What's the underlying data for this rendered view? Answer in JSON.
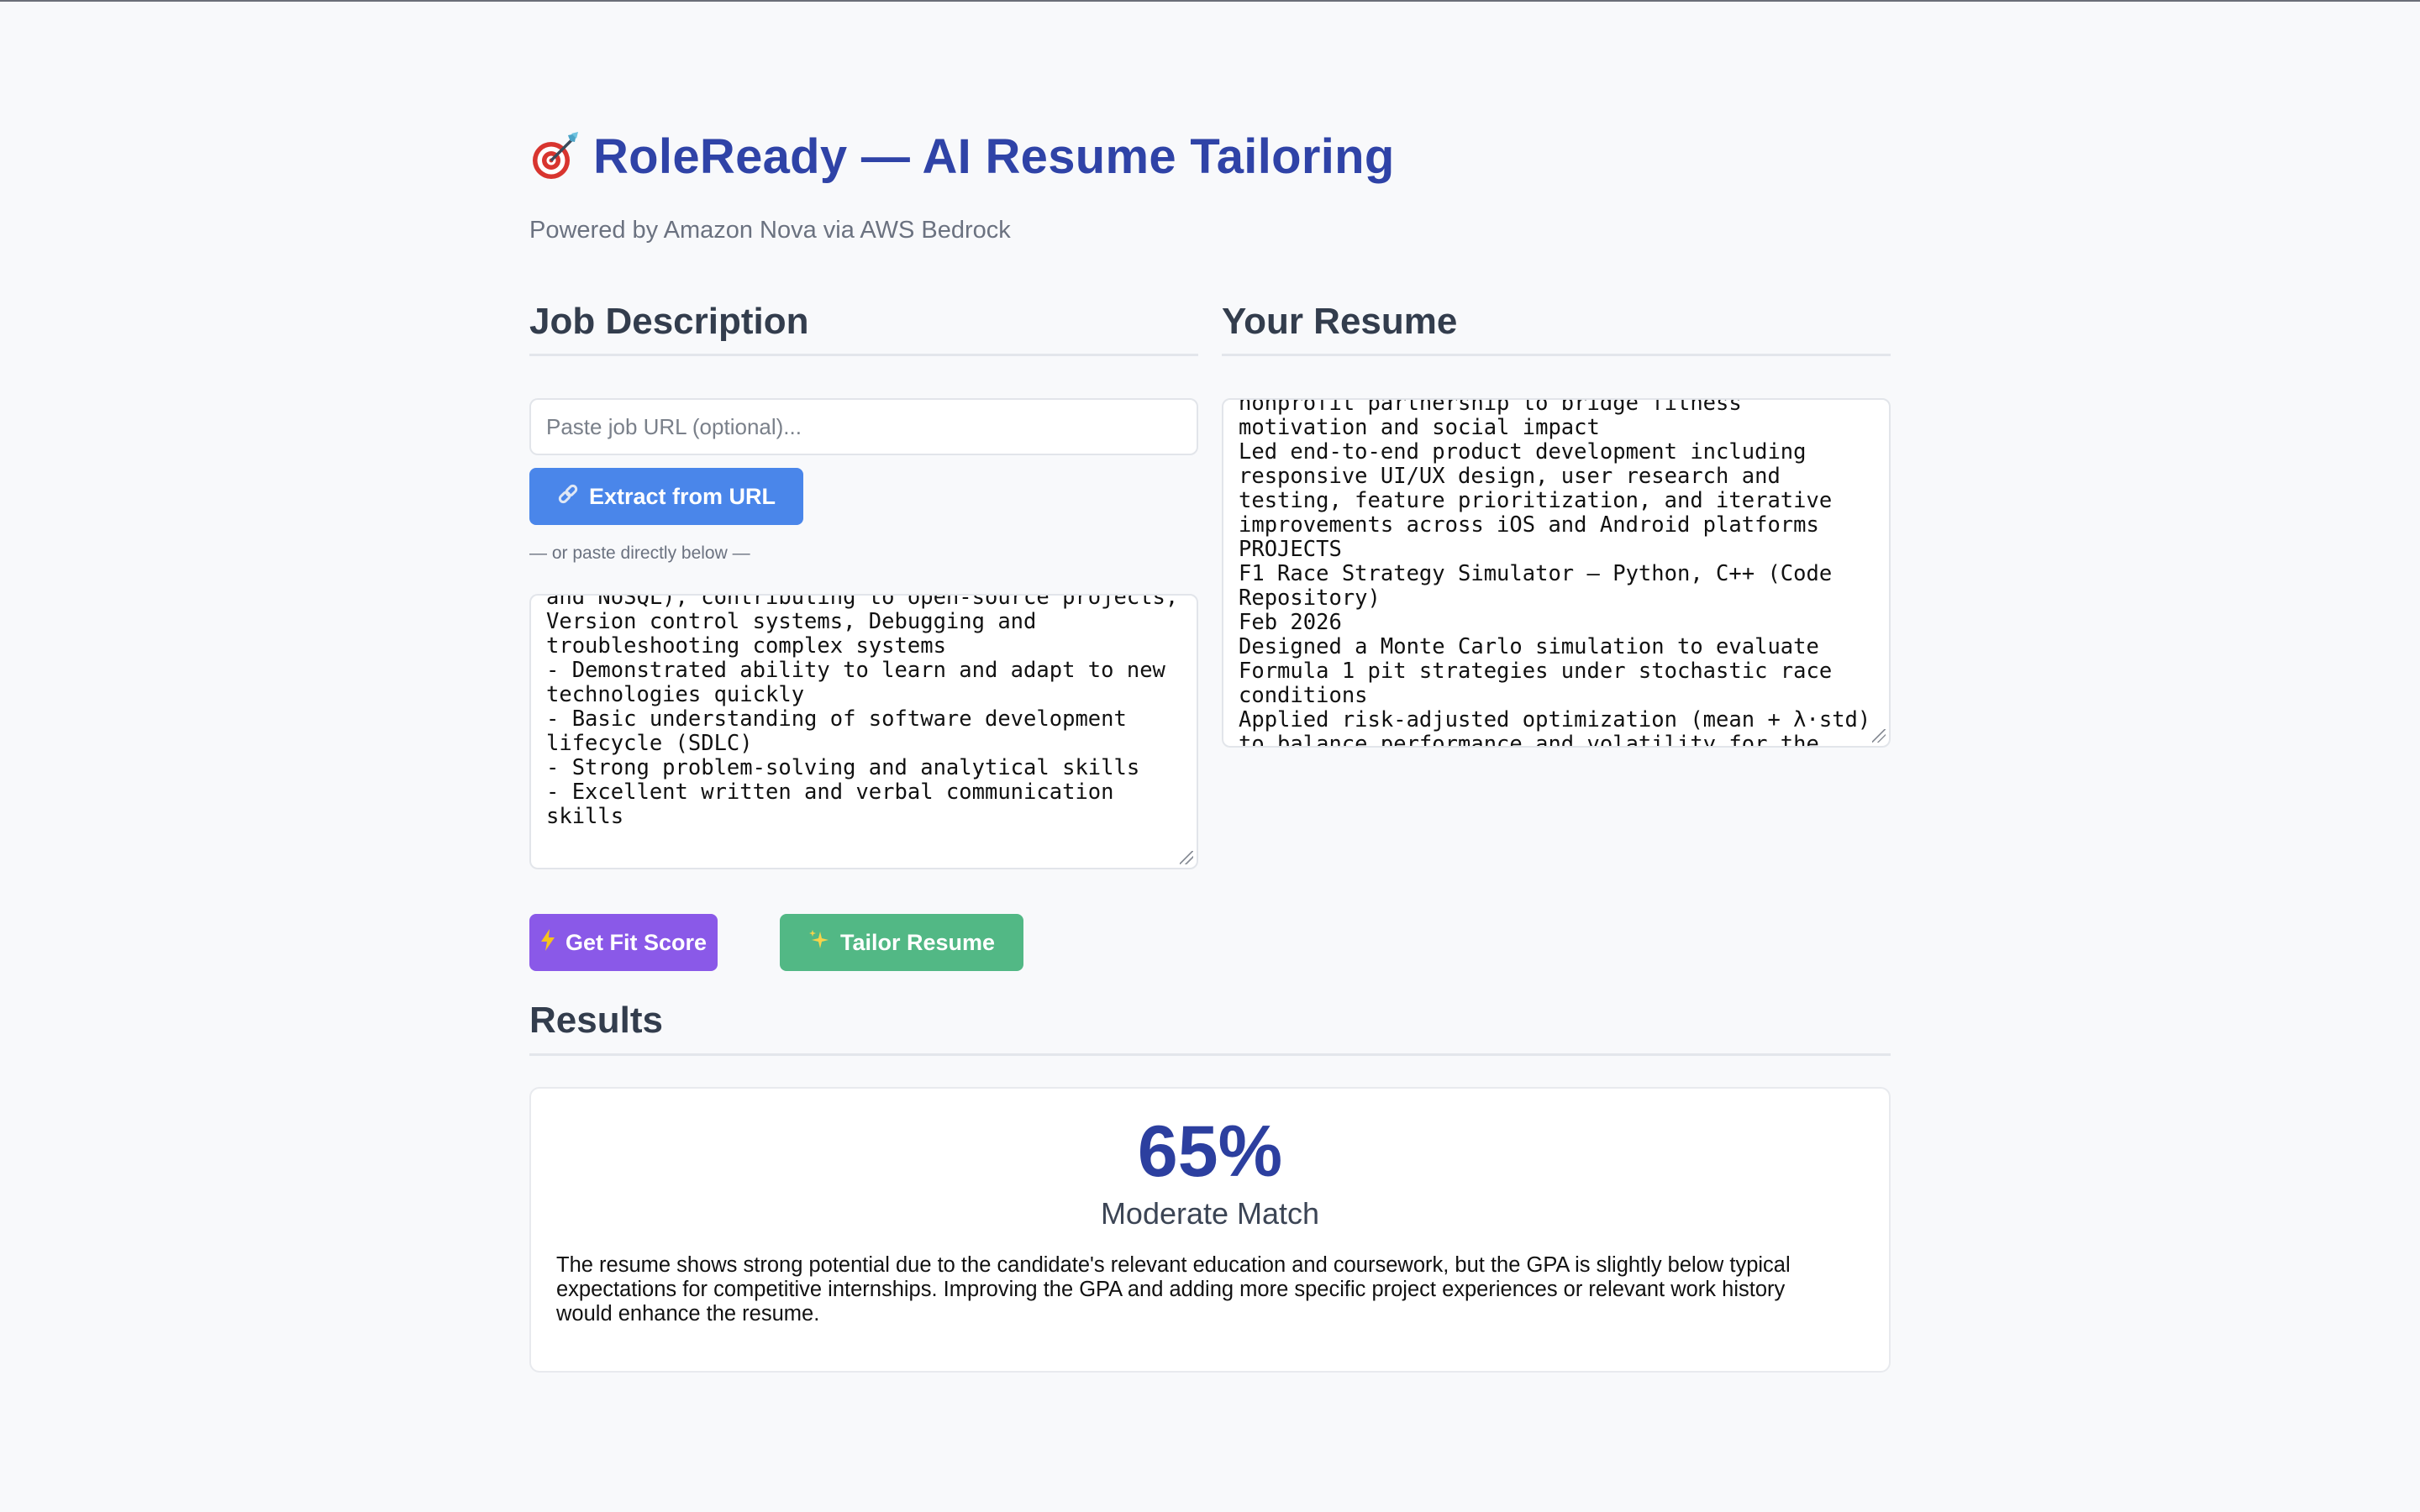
{
  "header": {
    "title": "RoleReady — AI Resume Tailoring",
    "logo_icon": "dart-target-icon",
    "subtitle": "Powered by Amazon Nova via AWS Bedrock"
  },
  "job_description": {
    "heading": "Job Description",
    "url_placeholder": "Paste job URL (optional)...",
    "extract_button": "Extract from URL",
    "extract_icon": "link-icon",
    "or_paste": "— or paste directly below —",
    "text": "and NoSQL), contributing to open-source projects,\nVersion control systems, Debugging and\ntroubleshooting complex systems\n- Demonstrated ability to learn and adapt to new\ntechnologies quickly\n- Basic understanding of software development\nlifecycle (SDLC)\n- Strong problem-solving and analytical skills\n- Excellent written and verbal communication\nskills"
  },
  "resume": {
    "heading": "Your Resume",
    "text": "nonprofit partnership to bridge fitness\nmotivation and social impact\nLed end-to-end product development including\nresponsive UI/UX design, user research and\ntesting, feature prioritization, and iterative\nimprovements across iOS and Android platforms\nPROJECTS\nF1 Race Strategy Simulator – Python, C++ (Code\nRepository)\nFeb 2026\nDesigned a Monte Carlo simulation to evaluate\nFormula 1 pit strategies under stochastic race\nconditions\nApplied risk-adjusted optimization (mean + λ·std)\nto balance performance and volatility for the"
  },
  "actions": {
    "fit_score_button": "Get Fit Score",
    "fit_score_icon": "lightning-icon",
    "tailor_button": "Tailor Resume",
    "tailor_icon": "sparkles-icon"
  },
  "results": {
    "heading": "Results",
    "score": "65%",
    "match_label": "Moderate Match",
    "summary": "The resume shows strong potential due to the candidate's relevant education and coursework, but the GPA is slightly below typical expectations for competitive internships. Improving the GPA and adding more specific project experiences or relevant work history would enhance the resume."
  },
  "colors": {
    "title": "#2f43a7",
    "extract_button": "#4a86ea",
    "fit_button": "#8a59e8",
    "tailor_button": "#52b885",
    "score": "#2c3f9f"
  }
}
